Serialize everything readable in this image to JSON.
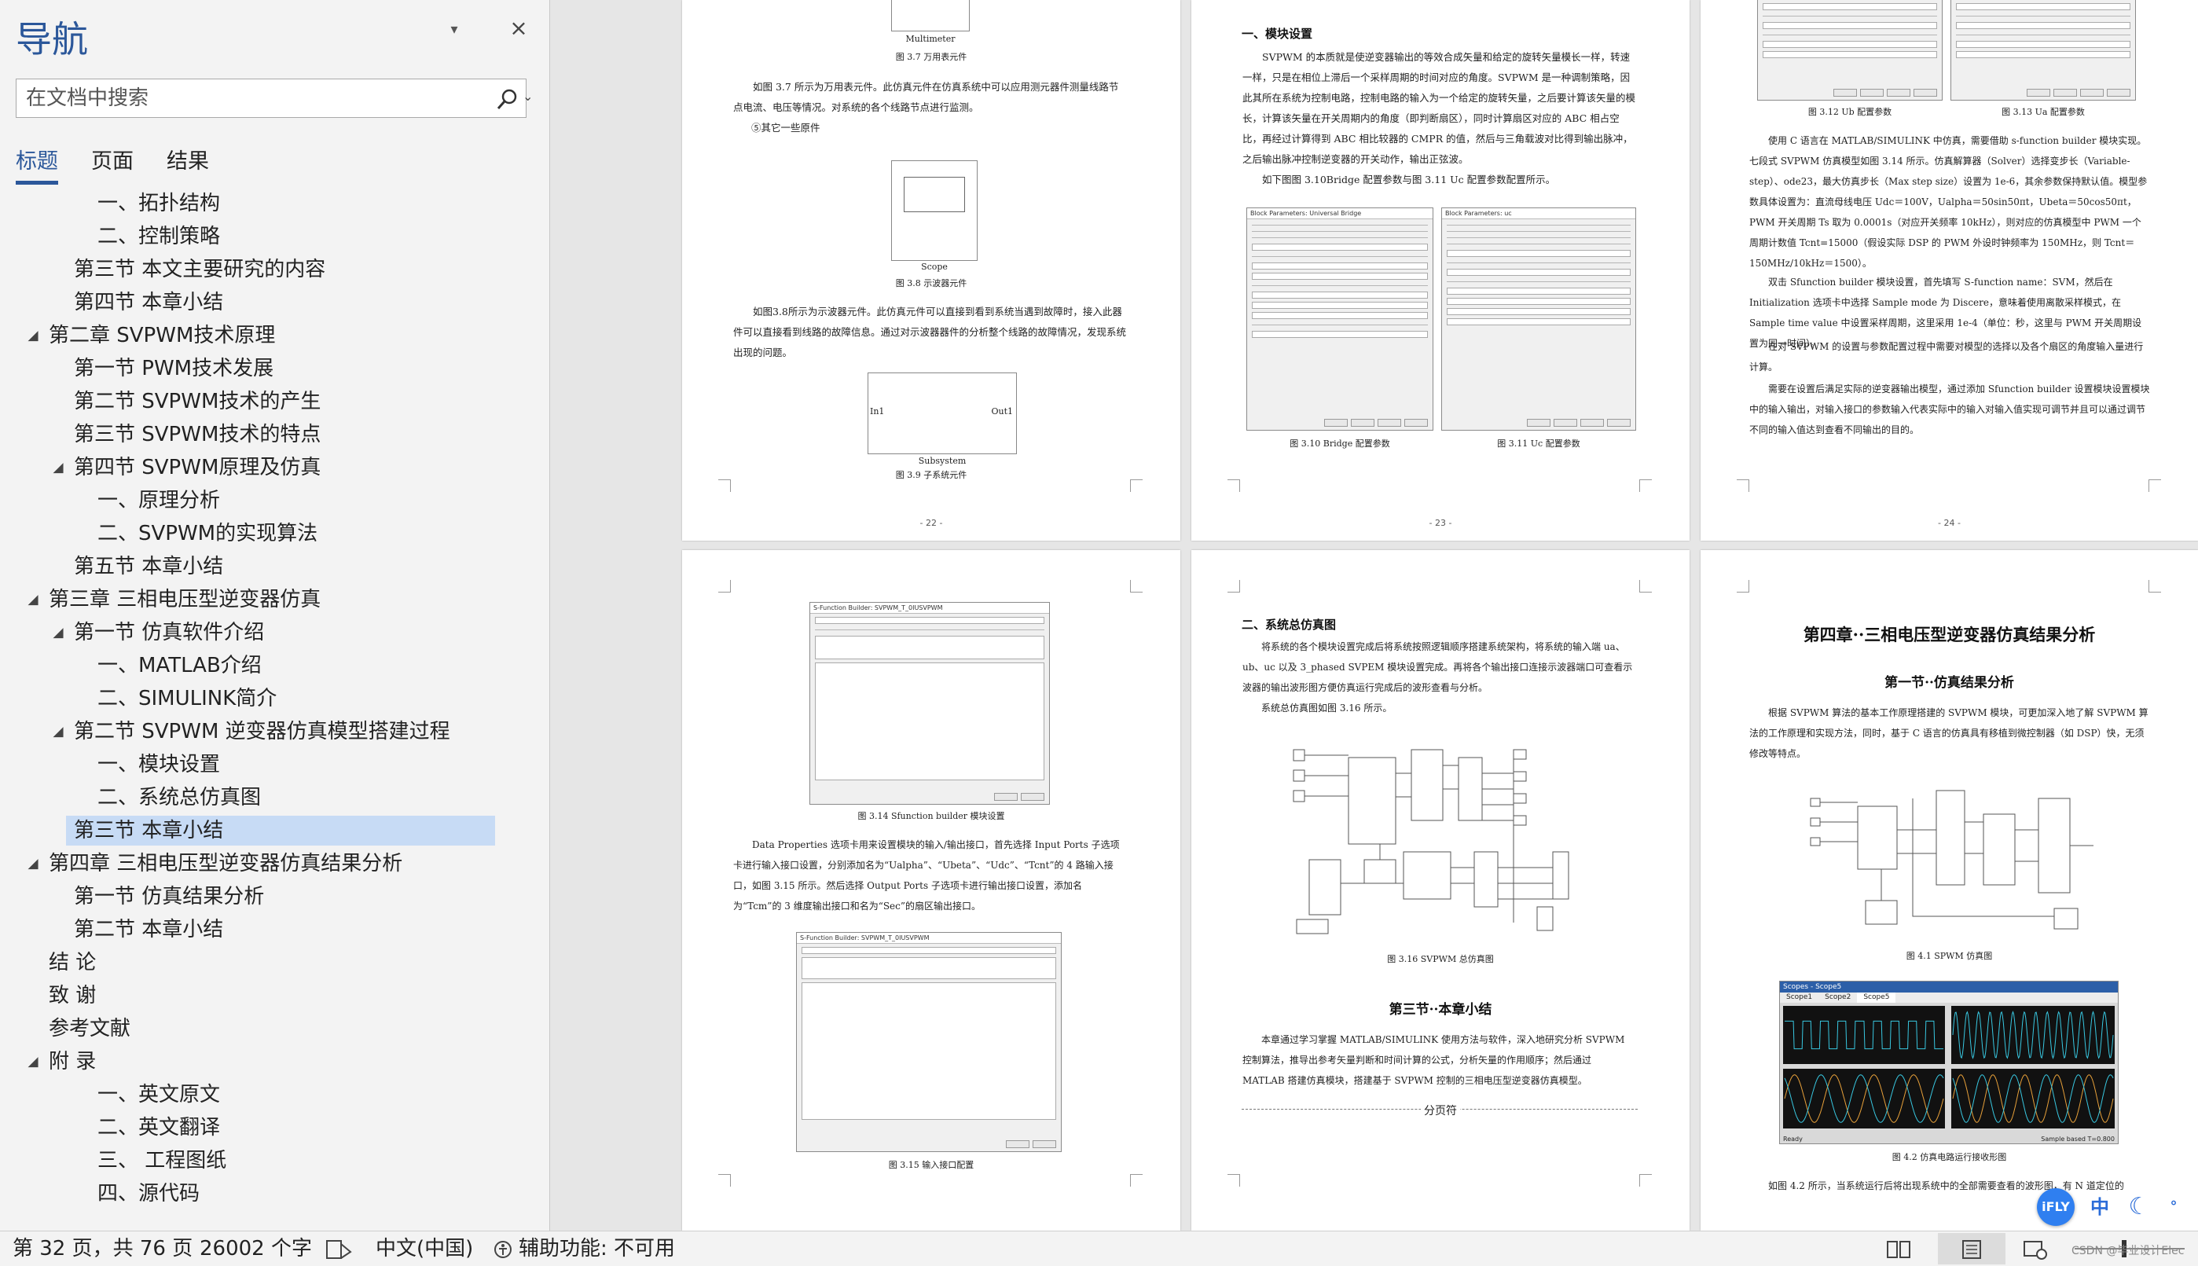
{
  "nav": {
    "title": "导航",
    "search_placeholder": "在文档中搜索",
    "tabs": [
      "标题",
      "页面",
      "结果"
    ],
    "tree": [
      {
        "label": "一、拓扑结构",
        "level": 2,
        "arrow": ""
      },
      {
        "label": "二、控制策略",
        "level": 2,
        "arrow": ""
      },
      {
        "label": "第三节  本文主要研究的内容",
        "level": 1,
        "arrow": ""
      },
      {
        "label": "第四节  本章小结",
        "level": 1,
        "arrow": ""
      },
      {
        "label": "第二章  SVPWM技术原理",
        "level": 0,
        "arrow": "◢"
      },
      {
        "label": "第一节  PWM技术发展",
        "level": 1,
        "arrow": ""
      },
      {
        "label": "第二节  SVPWM技术的产生",
        "level": 1,
        "arrow": ""
      },
      {
        "label": "第三节  SVPWM技术的特点",
        "level": 1,
        "arrow": ""
      },
      {
        "label": "第四节  SVPWM原理及仿真",
        "level": 1,
        "arrow": "◢"
      },
      {
        "label": "一、原理分析",
        "level": 2,
        "arrow": ""
      },
      {
        "label": "二、SVPWM的实现算法",
        "level": 2,
        "arrow": ""
      },
      {
        "label": "第五节  本章小结",
        "level": 1,
        "arrow": ""
      },
      {
        "label": "第三章  三相电压型逆变器仿真",
        "level": 0,
        "arrow": "◢"
      },
      {
        "label": "第一节  仿真软件介绍",
        "level": 1,
        "arrow": "◢"
      },
      {
        "label": "一、MATLAB介绍",
        "level": 2,
        "arrow": ""
      },
      {
        "label": "二、SIMULINK简介",
        "level": 2,
        "arrow": ""
      },
      {
        "label": "第二节  SVPWM 逆变器仿真模型搭建过程",
        "level": 1,
        "arrow": "◢"
      },
      {
        "label": "一、模块设置",
        "level": 2,
        "arrow": ""
      },
      {
        "label": "二、系统总仿真图",
        "level": 2,
        "arrow": ""
      },
      {
        "label": "第三节  本章小结",
        "level": 1,
        "arrow": "",
        "selected": true
      },
      {
        "label": "第四章  三相电压型逆变器仿真结果分析",
        "level": 0,
        "arrow": "◢"
      },
      {
        "label": "第一节  仿真结果分析",
        "level": 1,
        "arrow": ""
      },
      {
        "label": "第二节  本章小结",
        "level": 1,
        "arrow": ""
      },
      {
        "label": "结  论",
        "level": 0,
        "arrow": ""
      },
      {
        "label": "致  谢",
        "level": 0,
        "arrow": ""
      },
      {
        "label": "参考文献",
        "level": 0,
        "arrow": ""
      },
      {
        "label": "附  录",
        "level": 0,
        "arrow": "◢"
      },
      {
        "label": "一、英文原文",
        "level": 2,
        "arrow": ""
      },
      {
        "label": "二、英文翻译",
        "level": 2,
        "arrow": ""
      },
      {
        "label": "三、 工程图纸",
        "level": 2,
        "arrow": ""
      },
      {
        "label": "四、源代码",
        "level": 2,
        "arrow": ""
      }
    ]
  },
  "pages": {
    "p22": {
      "number": "- 22 -",
      "multimeter_label": "Multimeter",
      "cap_37": "图 3.7  万用表元件",
      "text_37": "如图 3.7 所示为万用表元件。此仿真元件在仿真系统中可以应用测元器件测量线路节点电流、电压等情况。对系统的各个线路节点进行监测。",
      "text_other": "⑤其它一些原件",
      "scope_label": "Scope",
      "cap_38": "图 3.8  示波器元件",
      "text_38": "如图3.8所示为示波器元件。此仿真元件可以直接到看到系统当遇到故障时，接入此器件可以直接看到线路的故障信息。通过对示波器器件的分析整个线路的故障情况，发现系统出现的问题。",
      "in1": "In1",
      "out1": "Out1",
      "subsystem_label": "Subsystem",
      "cap_39": "图 3.9  子系统元件"
    },
    "p23": {
      "number": "- 23 -",
      "heading": "一、模块设置",
      "text_1": "SVPWM 的本质就是使逆变器输出的等效合成矢量和给定的旋转矢量模长一样，转速一样，只是在相位上滞后一个采样周期的时间对应的角度。SVPWM 是一种调制策略，因此其所在系统为控制电路，控制电路的输入为一个给定的旋转矢量，之后要计算该矢量的模长，计算该矢量在开关周期内的角度（即判断扇区），同时计算扇区对应的 ABC 相占空比，再经过计算得到 ABC 相比较器的 CMPR 的值，然后与三角载波对比得到输出脉冲，之后输出脉冲控制逆变器的开关动作，输出正弦波。",
      "text_2": "如下图图 3.10Bridge 配置参数与图 3.11 Uc 配置参数配置所示。",
      "dlg_310_title": "Block Parameters: Universal Bridge",
      "dlg_311_title": "Block Parameters: uc",
      "cap_310": "图 3.10  Bridge 配置参数",
      "cap_311": "图 3.11 Uc 配置参数"
    },
    "p24": {
      "number": "- 24 -",
      "cap_312": "图 3.12  Ub 配置参数",
      "cap_313": "图 3.13 Ua 配置参数",
      "text_1": "使用 C 语言在 MATLAB/SIMULINK 中仿真，需要借助 s-function builder 模块实现。七段式 SVPWM 仿真模型如图 3.14 所示。仿真解算器（Solver）选择变步长（Variable-step）、ode23，最大仿真步长（Max step size）设置为 1e-6，其余参数保持默认值。模型参数具体设置为：直流母线电压 Udc＝100V，Ualpha＝50sin50πt，Ubeta＝50cos50πt，PWM 开关周期 Ts 取为 0.0001s（对应开关频率 10kHz），则对应的仿真模型中 PWM 一个周期计数值 Tcnt=15000（假设实际 DSP 的 PWM 外设时钟频率为 150MHz，则 Tcnt＝150MHz/10kHz＝1500）。",
      "text_2": "双击 Sfunction builder 模块设置，首先填写 S-function name：SVM，然后在 Initialization 选项卡中选择 Sample mode 为 Discere，意味着使用离散采样模式，在 Sample time value 中设置采样周期，这里采用 1e-4（单位：秒，这里与 PWM 开关周期设置为同一时间）。",
      "text_3": "在对 SVPWM 的设置与参数配置过程中需要对模型的选择以及各个扇区的角度输入量进行计算。",
      "text_4": "需要在设置后满足实际的逆变器输出模型，通过添加 Sfunction builder 设置模块设置模块中的输入输出，对输入接口的参数输入代表实际中的输入对输入值实现可调节并且可以通过调节不同的输入值达到查看不同输出的目的。"
    },
    "p25": {
      "number": "- 25 -",
      "dlg_314_title": "S-Function Builder: SVPWM_T_0IUSVPWM",
      "cap_314": "图 3.14 Sfunction builder 模块设置",
      "text_1": "Data Properties 选项卡用来设置模块的输入/输出接口，首先选择 Input Ports 子选项卡进行输入接口设置，分别添加名为“Ualpha”、“Ubeta”、“Udc”、“Tcnt”的 4 路输入接口，如图 3.15 所示。然后选择 Output Ports 子选项卡进行输出接口设置，添加名为“Tcm”的 3 维度输出接口和名为“Sec”的扇区输出接口。",
      "dlg_315_title": "S-Function Builder: SVPWM_T_0IUSVPWM",
      "cap_315": "图 3.15  输入接口配置"
    },
    "p26": {
      "number": "- 26 -",
      "heading": "二、系统总仿真图",
      "text_1": "将系统的各个模块设置完成后将系统按照逻辑顺序搭建系统架构，将系统的输入端 ua、ub、uc 以及 3_phased SVPEM 模块设置完成。再将各个输出接口连接示波器端口可查看示波器的输出波形图方便仿真运行完成后的波形查看与分析。",
      "text_2": "系统总仿真图如图 3.16 所示。",
      "cap_316": "图 3.16 SVPWM 总仿真图",
      "section": "第三节··本章小结",
      "text_3": "本章通过学习掌握 MATLAB/SIMULINK 使用方法与软件，深入地研究分析 SVPWM 控制算法，推导出参考矢量判断和时间计算的公式，分析矢量的作用顺序；然后通过 MATLAB 搭建仿真模块，搭建基于 SVPWM 控制的三相电压型逆变器仿真模型。",
      "page_break": "分页符"
    },
    "p27": {
      "number": "- 27 -",
      "chapter": "第四章··三相电压型逆变器仿真结果分析",
      "section": "第一节··仿真结果分析",
      "text_1": "根据 SVPWM 算法的基本工作原理搭建的 SVPWM 模块，可更加深入地了解 SVPWM 算法的工作原理和实现方法，同时，基于 C 语言的仿真具有移植到微控制器（如 DSP）快，无须修改等特点。",
      "cap_41": "图 4.1 SPWM 仿真图",
      "scope_title": "Scopes - Scope5",
      "scope_tabs": [
        "Scope1",
        "Scope2",
        "Scope5"
      ],
      "scope_status_left": "Ready",
      "scope_status_right": "Sample based    T=0.800",
      "cap_42": "图 4.2  仿真电路运行接收形图",
      "text_2": "如图 4.2 所示，当系统运行后将出现系统中的全部需要查看的波形图，有 N 道定位的"
    }
  },
  "status": {
    "page": "第 32 页，共 76 页",
    "words": "26002 个字",
    "language": "中文(中国)",
    "accessibility": "辅助功能: 不可用"
  },
  "ime": {
    "brand": "iFLY",
    "lang": "中"
  },
  "watermark": "CSDN @毕业设计Elec",
  "colors": {
    "accent": "#2b579a",
    "selected": "#c7dbf5",
    "scope_bg": "#111111",
    "wave_cyan": "#38c7e0",
    "wave_orange": "#e8a13a"
  }
}
